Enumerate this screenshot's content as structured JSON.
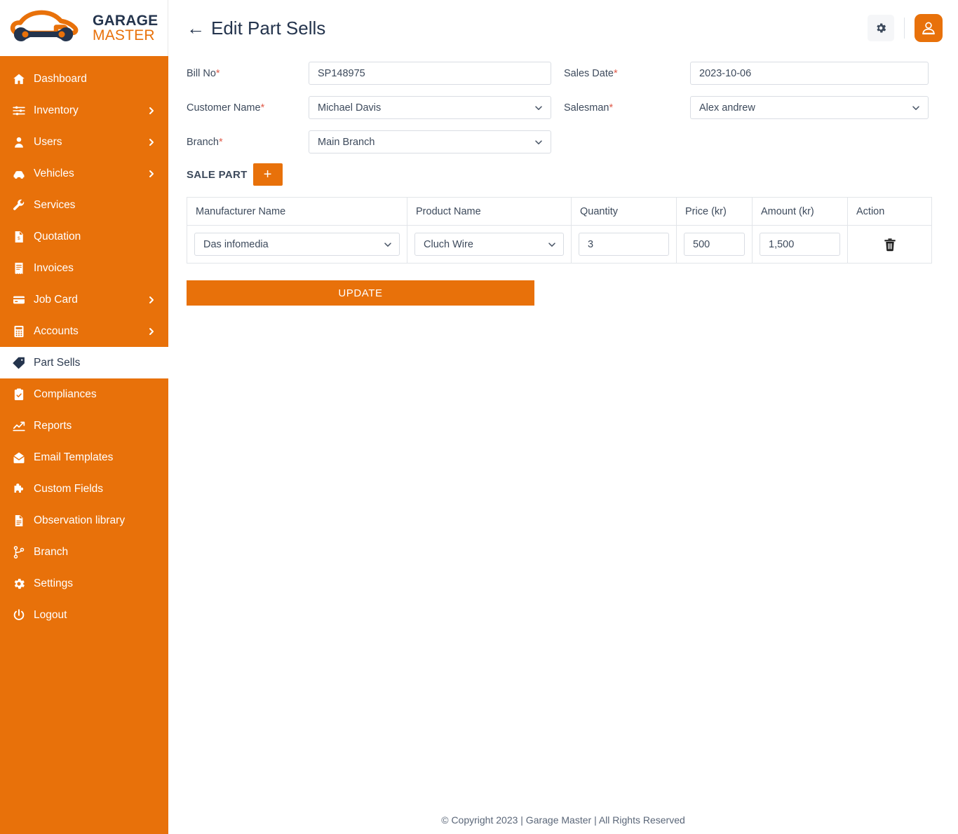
{
  "brand": {
    "logo_line1": "GARAGE",
    "logo_line2": "MASTER",
    "accent_color": "#E8710A",
    "dark_color": "#24344D"
  },
  "sidebar": {
    "items": [
      {
        "label": "Dashboard",
        "icon": "home-icon",
        "has_chevron": false,
        "active": false
      },
      {
        "label": "Inventory",
        "icon": "sliders-icon",
        "has_chevron": true,
        "active": false
      },
      {
        "label": "Users",
        "icon": "user-icon",
        "has_chevron": true,
        "active": false
      },
      {
        "label": "Vehicles",
        "icon": "car-icon",
        "has_chevron": true,
        "active": false
      },
      {
        "label": "Services",
        "icon": "wrench-icon",
        "has_chevron": false,
        "active": false
      },
      {
        "label": "Quotation",
        "icon": "quote-doc-icon",
        "has_chevron": false,
        "active": false
      },
      {
        "label": "Invoices",
        "icon": "invoice-icon",
        "has_chevron": false,
        "active": false
      },
      {
        "label": "Job Card",
        "icon": "card-icon",
        "has_chevron": true,
        "active": false
      },
      {
        "label": "Accounts",
        "icon": "calculator-icon",
        "has_chevron": true,
        "active": false
      },
      {
        "label": "Part Sells",
        "icon": "tag-icon",
        "has_chevron": false,
        "active": true
      },
      {
        "label": "Compliances",
        "icon": "clipboard-check-icon",
        "has_chevron": false,
        "active": false
      },
      {
        "label": "Reports",
        "icon": "chart-line-icon",
        "has_chevron": false,
        "active": false
      },
      {
        "label": "Email Templates",
        "icon": "mail-open-icon",
        "has_chevron": false,
        "active": false
      },
      {
        "label": "Custom Fields",
        "icon": "puzzle-icon",
        "has_chevron": false,
        "active": false
      },
      {
        "label": "Observation library",
        "icon": "document-icon",
        "has_chevron": false,
        "active": false
      },
      {
        "label": "Branch",
        "icon": "branch-icon",
        "has_chevron": false,
        "active": false
      },
      {
        "label": "Settings",
        "icon": "gear-icon",
        "has_chevron": false,
        "active": false
      },
      {
        "label": "Logout",
        "icon": "power-icon",
        "has_chevron": false,
        "active": false
      }
    ]
  },
  "header": {
    "title": "Edit Part Sells",
    "back_arrow": "←",
    "settings_icon": "gear-icon",
    "avatar_icon": "user-avatar-icon"
  },
  "form": {
    "bill_no": {
      "label": "Bill No",
      "required": "*",
      "value": "SP148975"
    },
    "sales_date": {
      "label": "Sales Date",
      "required": "*",
      "value": "2023-10-06"
    },
    "customer_name": {
      "label": "Customer Name",
      "required": "*",
      "value": "Michael Davis"
    },
    "salesman": {
      "label": "Salesman",
      "required": "*",
      "value": "Alex andrew"
    },
    "branch": {
      "label": "Branch",
      "required": "*",
      "value": "Main Branch"
    }
  },
  "sale_part": {
    "title": "SALE PART",
    "add_label": "+",
    "columns": [
      "Manufacturer Name",
      "Product Name",
      "Quantity",
      "Price (kr)",
      "Amount (kr)",
      "Action"
    ],
    "rows": [
      {
        "manufacturer": "Das infomedia",
        "product": "Cluch Wire",
        "quantity": "3",
        "price": "500",
        "amount": "1,500",
        "action_icon": "trash-icon"
      }
    ]
  },
  "actions": {
    "update_label": "UPDATE"
  },
  "footer": {
    "text": "© Copyright 2023 | Garage Master | All Rights Reserved"
  }
}
